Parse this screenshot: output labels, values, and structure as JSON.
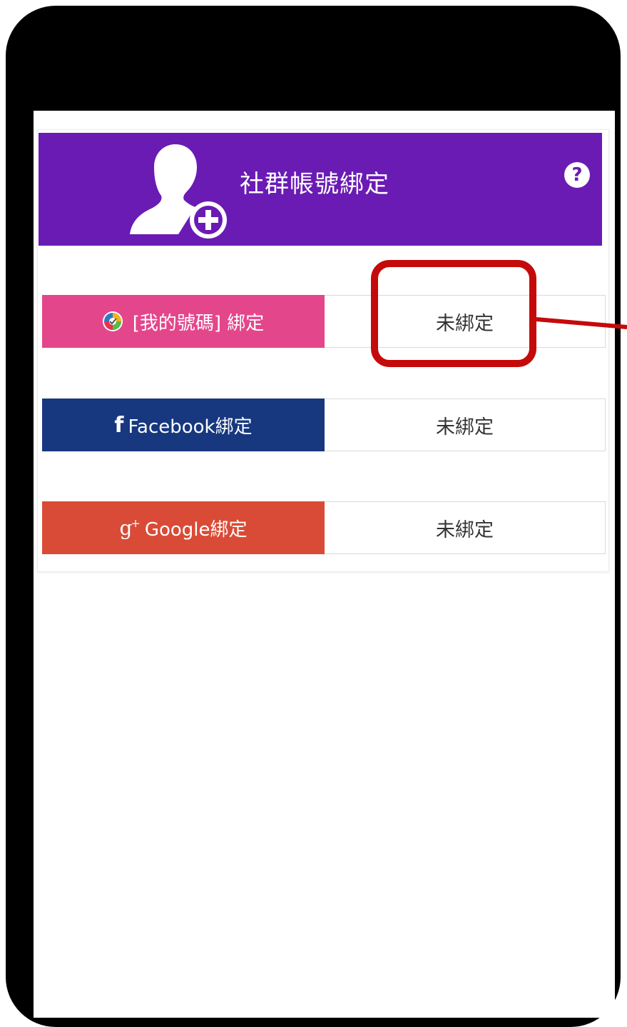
{
  "header": {
    "title": "社群帳號綁定",
    "help_icon": "question-circle-icon",
    "person_icon": "add-person-icon",
    "color": "#6a1bb4"
  },
  "bindings": [
    {
      "label": "[我的號碼] 綁定",
      "icon": "mycode-icon",
      "status": "未綁定",
      "color": "#e4468b"
    },
    {
      "label": "Facebook綁定",
      "icon": "facebook-icon",
      "icon_text": "f",
      "status": "未綁定",
      "color": "#17387f"
    },
    {
      "label": "Google綁定",
      "icon": "google-plus-icon",
      "icon_text": "g",
      "icon_sup": "+",
      "status": "未綁定",
      "color": "#d94b36"
    }
  ],
  "annotation": {
    "color": "#c40a0a"
  }
}
